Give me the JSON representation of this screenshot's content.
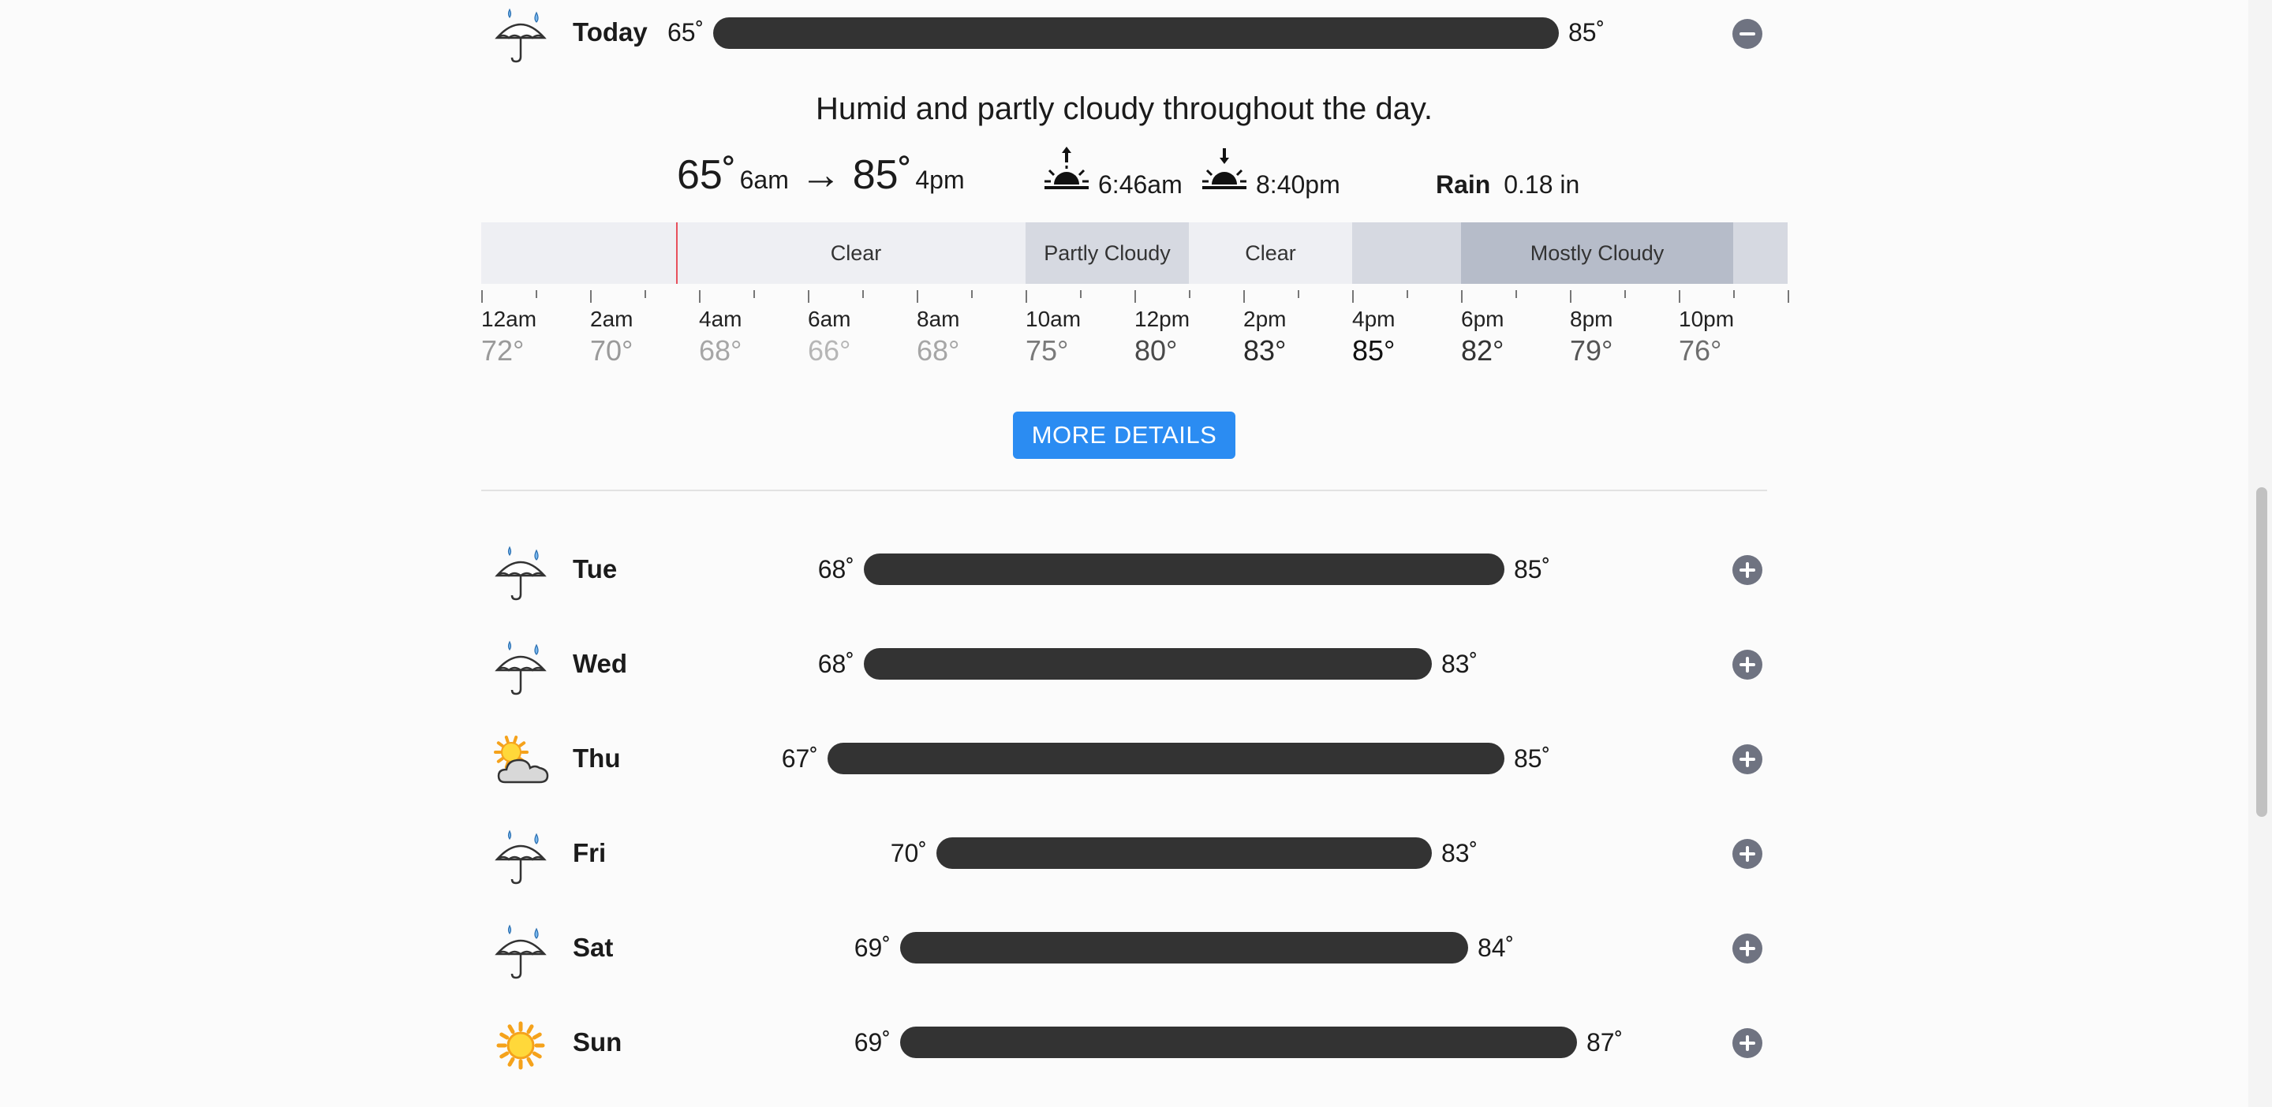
{
  "today": {
    "day": "Today",
    "min_temp": "65˚",
    "max_temp": "85˚",
    "icon": "rain-umbrella-icon",
    "summary": "Humid and partly cloudy throughout the day.",
    "low": {
      "temp": "65˚",
      "time": "6am"
    },
    "arrow": "→",
    "high": {
      "temp": "85˚",
      "time": "4pm"
    },
    "sunrise": "6:46am",
    "sunset": "8:40pm",
    "rain_label": "Rain",
    "rain_value": "0.18 in",
    "conditions": [
      {
        "label": "Clear",
        "color": "#eeeff3"
      },
      {
        "label": "Partly Cloudy",
        "color": "#d6d9e1"
      },
      {
        "label": "Clear",
        "color": "#eeeff3"
      },
      {
        "label": "",
        "color": "#d6d9e1"
      },
      {
        "label": "Mostly Cloudy",
        "color": "#b6bcc9"
      },
      {
        "label": "",
        "color": "#d6d9e1"
      }
    ],
    "hours": [
      {
        "time": "12am",
        "temp": "72°",
        "color": "#9a9a9a"
      },
      {
        "time": "2am",
        "temp": "70°",
        "color": "#9a9a9a"
      },
      {
        "time": "4am",
        "temp": "68°",
        "color": "#a6a6a6"
      },
      {
        "time": "6am",
        "temp": "66°",
        "color": "#b6b6b6"
      },
      {
        "time": "8am",
        "temp": "68°",
        "color": "#a6a6a6"
      },
      {
        "time": "10am",
        "temp": "75°",
        "color": "#7a7a7a"
      },
      {
        "time": "12pm",
        "temp": "80°",
        "color": "#4a4a4a"
      },
      {
        "time": "2pm",
        "temp": "83°",
        "color": "#2a2a2a"
      },
      {
        "time": "4pm",
        "temp": "85°",
        "color": "#111111"
      },
      {
        "time": "6pm",
        "temp": "82°",
        "color": "#333333"
      },
      {
        "time": "8pm",
        "temp": "79°",
        "color": "#555555"
      },
      {
        "time": "10pm",
        "temp": "76°",
        "color": "#6e6e6e"
      }
    ],
    "more_details": "MORE DETAILS"
  },
  "week": [
    {
      "day": "Tue",
      "min_temp": "68˚",
      "max_temp": "85˚",
      "min": 68,
      "max": 85,
      "icon": "rain-umbrella-icon"
    },
    {
      "day": "Wed",
      "min_temp": "68˚",
      "max_temp": "83˚",
      "min": 68,
      "max": 83,
      "icon": "rain-umbrella-icon"
    },
    {
      "day": "Thu",
      "min_temp": "67˚",
      "max_temp": "85˚",
      "min": 67,
      "max": 85,
      "icon": "partly-cloudy-icon"
    },
    {
      "day": "Fri",
      "min_temp": "70˚",
      "max_temp": "83˚",
      "min": 70,
      "max": 83,
      "icon": "rain-umbrella-icon"
    },
    {
      "day": "Sat",
      "min_temp": "69˚",
      "max_temp": "84˚",
      "min": 69,
      "max": 84,
      "icon": "rain-umbrella-icon"
    },
    {
      "day": "Sun",
      "min_temp": "69˚",
      "max_temp": "87˚",
      "min": 69,
      "max": 87,
      "icon": "sun-icon"
    }
  ],
  "colors": {
    "bar": "#333333",
    "button": "#2b8cf2",
    "toggle": "#6f7381",
    "now_marker": "#e8505b"
  }
}
